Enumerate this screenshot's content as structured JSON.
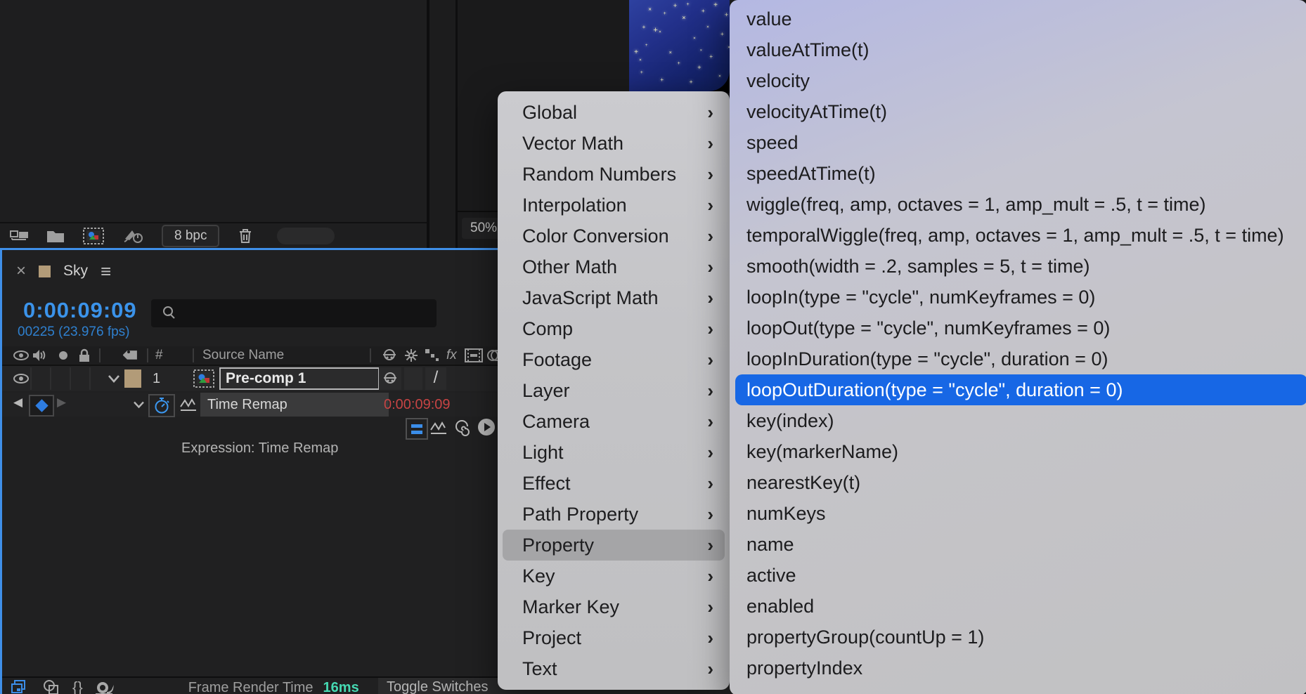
{
  "project_panel": {
    "bit_depth_label": "8 bpc",
    "icons": [
      "render-queue-icon",
      "folder-icon",
      "new-composition-icon",
      "rocket-power-icon",
      "trash-icon"
    ]
  },
  "comp_viewer": {
    "zoom_level": "50%",
    "stars": [
      [
        5,
        58,
        10,
        0
      ],
      [
        9,
        66,
        7,
        45
      ],
      [
        13,
        30,
        8,
        0
      ],
      [
        11,
        80,
        7,
        0
      ],
      [
        19,
        10,
        9,
        45
      ],
      [
        24,
        33,
        11,
        0
      ],
      [
        29,
        35,
        7,
        45
      ],
      [
        31,
        88,
        8,
        0
      ],
      [
        34,
        15,
        7,
        0
      ],
      [
        39,
        58,
        8,
        45
      ],
      [
        44,
        6,
        9,
        0
      ],
      [
        48,
        70,
        7,
        0
      ],
      [
        52,
        20,
        10,
        45
      ],
      [
        57,
        5,
        7,
        0
      ],
      [
        60,
        90,
        8,
        0
      ],
      [
        63,
        42,
        7,
        45
      ],
      [
        68,
        74,
        9,
        0
      ],
      [
        72,
        12,
        8,
        0
      ],
      [
        76,
        30,
        7,
        45
      ],
      [
        80,
        62,
        8,
        0
      ],
      [
        84,
        6,
        10,
        0
      ],
      [
        88,
        84,
        7,
        45
      ],
      [
        91,
        38,
        8,
        0
      ],
      [
        95,
        16,
        9,
        0
      ],
      [
        97,
        52,
        7,
        45
      ],
      [
        16,
        50,
        6,
        0
      ],
      [
        70,
        55,
        6,
        45
      ]
    ]
  },
  "timeline": {
    "tab": {
      "name": "Sky",
      "close_glyph": "×",
      "menu_glyph": "≡"
    },
    "current_time": "0:00:09:09",
    "frame_info": "00225 (23.976 fps)",
    "columns": {
      "index_label": "#",
      "source_name_label": "Source Name"
    },
    "layer": {
      "index": "1",
      "name": "Pre-comp 1",
      "quality_glyph": "/"
    },
    "property": {
      "name": "Time Remap",
      "value": "0:00:09:09"
    },
    "expression_label": "Expression: Time Remap",
    "keyframe_nav": {
      "prev_glyph": "◀",
      "next_glyph": "▶"
    },
    "status_bar": {
      "render_time_label": "Frame Render Time",
      "render_time_value": "16ms",
      "toggle_label": "Toggle Switches",
      "braces_glyph": "{}"
    }
  },
  "menu": {
    "items": [
      {
        "label": "Global"
      },
      {
        "label": "Vector Math"
      },
      {
        "label": "Random Numbers"
      },
      {
        "label": "Interpolation"
      },
      {
        "label": "Color Conversion"
      },
      {
        "label": "Other Math"
      },
      {
        "label": "JavaScript Math"
      },
      {
        "label": "Comp"
      },
      {
        "label": "Footage"
      },
      {
        "label": "Layer"
      },
      {
        "label": "Camera"
      },
      {
        "label": "Light"
      },
      {
        "label": "Effect"
      },
      {
        "label": "Path Property"
      },
      {
        "label": "Property",
        "highlighted": true
      },
      {
        "label": "Key"
      },
      {
        "label": "Marker Key"
      },
      {
        "label": "Project"
      },
      {
        "label": "Text"
      }
    ],
    "chevron_glyph": "›"
  },
  "submenu": {
    "items": [
      "value",
      "valueAtTime(t)",
      "velocity",
      "velocityAtTime(t)",
      "speed",
      "speedAtTime(t)",
      "wiggle(freq, amp, octaves = 1, amp_mult = .5, t = time)",
      "temporalWiggle(freq, amp, octaves = 1, amp_mult = .5, t = time)",
      "smooth(width = .2, samples = 5, t = time)",
      "loopIn(type = \"cycle\", numKeyframes = 0)",
      "loopOut(type = \"cycle\", numKeyframes = 0)",
      "loopInDuration(type = \"cycle\", duration = 0)",
      "loopOutDuration(type = \"cycle\", duration = 0)",
      "key(index)",
      "key(markerName)",
      "nearestKey(t)",
      "numKeys",
      "name",
      "active",
      "enabled",
      "propertyGroup(countUp = 1)",
      "propertyIndex"
    ],
    "highlight_index": 12,
    "highlight_color": "#1767e5"
  },
  "colors": {
    "accent_blue": "#3f8fe8",
    "timecode_blue": "#3b93ea",
    "value_red": "#c74444",
    "render_time_teal": "#45d9b2",
    "label_tan": "#b29b78",
    "selection_blue": "#1767e5"
  }
}
